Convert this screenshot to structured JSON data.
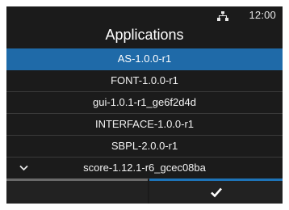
{
  "status_bar": {
    "time": "12:00",
    "network_icon": "network-icon"
  },
  "header": {
    "title": "Applications"
  },
  "app_list": {
    "items": [
      {
        "label": "AS-1.0.0-r1",
        "selected": true
      },
      {
        "label": "FONT-1.0.0-r1",
        "selected": false
      },
      {
        "label": "gui-1.0.1-r1_ge6f2d4d",
        "selected": false
      },
      {
        "label": "INTERFACE-1.0.0-r1",
        "selected": false
      },
      {
        "label": "SBPL-2.0.0-r1",
        "selected": false
      },
      {
        "label": "score-1.12.1-r6_gcec08ba",
        "selected": false
      }
    ],
    "more_indicator_icon": "chevron-down-icon"
  },
  "footer": {
    "left_icon": "",
    "right_icon": "checkmark-icon"
  },
  "colors": {
    "background": "#1b1b1b",
    "selection": "#1f6aa8",
    "accent": "#1e74b8",
    "text": "#ffffff"
  }
}
